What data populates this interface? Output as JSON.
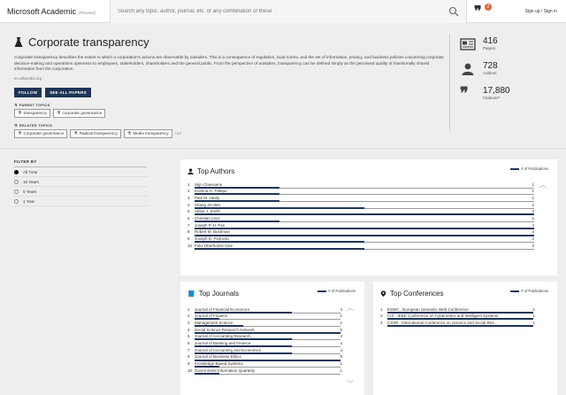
{
  "header": {
    "app_name": "Microsoft Academic",
    "preview": "(Preview)",
    "search_placeholder": "Search any topic, author, journal, etc. or any combination of these",
    "quote_badge": "2",
    "auth": "Sign up / Sign in"
  },
  "topic": {
    "title": "Corporate transparency",
    "description": "Corporate transparency describes the extent to which a corporation's actions are observable by outsiders. This is a consequence of regulation, local norms, and the set of information, privacy, and business policies concerning corporate decision-making and operations openness to employees, stakeholders, shareholders and the general public. From the perspective of outsiders, transparency can be defined simply as the perceived quality of intentionally shared information from the corporation.",
    "source": "en.wikipedia.org",
    "follow_label": "FOLLOW",
    "see_all_label": "SEE ALL PAPERS",
    "parent_label": "PARENT TOPICS",
    "parent_topics": [
      "transparency",
      "corporate governance"
    ],
    "related_label": "RELATED TOPICS",
    "related_topics": [
      "Corporate governance",
      "Radical transparency",
      "Media transparency"
    ],
    "related_more": "+17"
  },
  "stats": {
    "papers": "416",
    "papers_label": "Papers",
    "authors": "728",
    "authors_label": "Authors",
    "citations": "17,880",
    "citations_label": "Citations*"
  },
  "filter": {
    "title": "FILTER BY",
    "options": [
      "All Time",
      "10 Years",
      "5 Years",
      "1 Year"
    ],
    "selected": 0
  },
  "top_authors": {
    "title": "Top Authors",
    "legend": "# of Publications",
    "max": 4,
    "rows": [
      {
        "name": "Stijn Claessens",
        "count": 1
      },
      {
        "name": "Krishna G. Palepu",
        "count": 1
      },
      {
        "name": "Paul M. Healy",
        "count": 1
      },
      {
        "name": "Shang Jin Wei",
        "count": 2
      },
      {
        "name": "Abbie J. Smith",
        "count": 4
      },
      {
        "name": "Christian Leuz",
        "count": 1
      },
      {
        "name": "Joseph P. H. Fan",
        "count": 4
      },
      {
        "name": "Robert M. Bushman",
        "count": 4
      },
      {
        "name": "Joseph D. Piotroski",
        "count": 2
      },
      {
        "name": "Felix Oberholzer-Gee",
        "count": 2
      }
    ]
  },
  "top_journals": {
    "title": "Top Journals",
    "legend": "# of Publications",
    "max": 6,
    "rows": [
      {
        "name": "Journal of Financial Economics",
        "count": 4
      },
      {
        "name": "Journal of Finance",
        "count": 1
      },
      {
        "name": "Management Science",
        "count": 2
      },
      {
        "name": "Social Science Research Network",
        "count": 6
      },
      {
        "name": "Journal of Accounting Research",
        "count": 4
      },
      {
        "name": "Journal of Banking and Finance",
        "count": 4
      },
      {
        "name": "Journal of Accounting and Economics",
        "count": 4
      },
      {
        "name": "Journal of Business Ethics",
        "count": 9
      },
      {
        "name": "Knowledge Based Systems",
        "count": 1
      },
      {
        "name": "Government Information Quarterly",
        "count": 1
      }
    ]
  },
  "top_conferences": {
    "title": "Top Conferences",
    "legend": "# of Publications",
    "max": 1,
    "rows": [
      {
        "name": "ESWC : European Semantic Web Conference",
        "count": 1
      },
      {
        "name": "CIS - IEEE Conference on Cybernetics and Intelligent Systems",
        "count": 1
      },
      {
        "name": "CSSR : International Conference on Science and Social Res...",
        "count": 1
      }
    ]
  },
  "colors": {
    "accent": "#1e3557",
    "badge": "#e0653a"
  }
}
